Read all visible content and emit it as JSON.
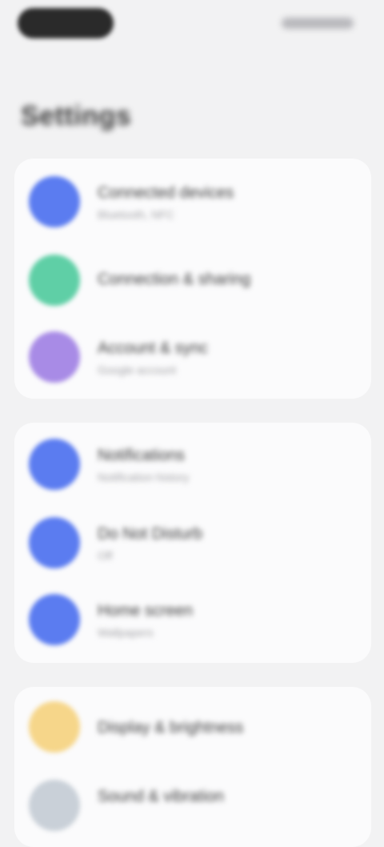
{
  "status_bar": {
    "time": "",
    "indicators": ""
  },
  "page_title": "Settings",
  "groups": [
    {
      "items": [
        {
          "title": "Connected devices",
          "subtitle": "Bluetooth, NFC",
          "icon": "devices-icon",
          "color": "#5b7cf0"
        },
        {
          "title": "Connection & sharing",
          "subtitle": "",
          "icon": "share-icon",
          "color": "#5fcfa6"
        },
        {
          "title": "Account & sync",
          "subtitle": "Google account",
          "icon": "account-icon",
          "color": "#a88be6"
        }
      ]
    },
    {
      "items": [
        {
          "title": "Notifications",
          "subtitle": "Notification history",
          "icon": "bell-icon",
          "color": "#5b7cf0"
        },
        {
          "title": "Do Not Disturb",
          "subtitle": "Off",
          "icon": "moon-icon",
          "color": "#5b7cf0"
        },
        {
          "title": "Home screen",
          "subtitle": "Wallpapers",
          "icon": "home-icon",
          "color": "#5b7cf0"
        }
      ]
    },
    {
      "items": [
        {
          "title": "Display & brightness",
          "subtitle": "",
          "icon": "sun-icon",
          "color": "#f6d68a"
        },
        {
          "title": "Sound & vibration",
          "subtitle": "",
          "icon": "speaker-icon",
          "color": "#c9d0d8"
        }
      ]
    }
  ]
}
